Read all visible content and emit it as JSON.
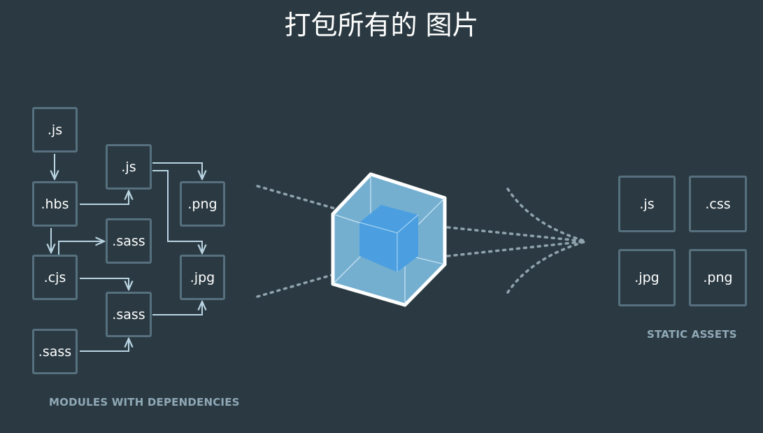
{
  "title": "打包所有的 图片",
  "modules": {
    "caption": "MODULES WITH DEPENDENCIES",
    "boxes": {
      "js1": ".js",
      "js2": ".js",
      "hbs": ".hbs",
      "png": ".png",
      "sass1": ".sass",
      "cjs": ".cjs",
      "jpg": ".jpg",
      "sass2": ".sass",
      "sass3": ".sass"
    }
  },
  "assets": {
    "caption": "STATIC ASSETS",
    "items": [
      ".js",
      ".css",
      ".jpg",
      ".png"
    ]
  },
  "colors": {
    "background": "#2b3a42",
    "box_border": "#56707e",
    "arrow": "#b9d4e2",
    "cube_outer": "#75afd0",
    "cube_inner": "#4b9fe0",
    "caption": "#8fa8b6"
  }
}
